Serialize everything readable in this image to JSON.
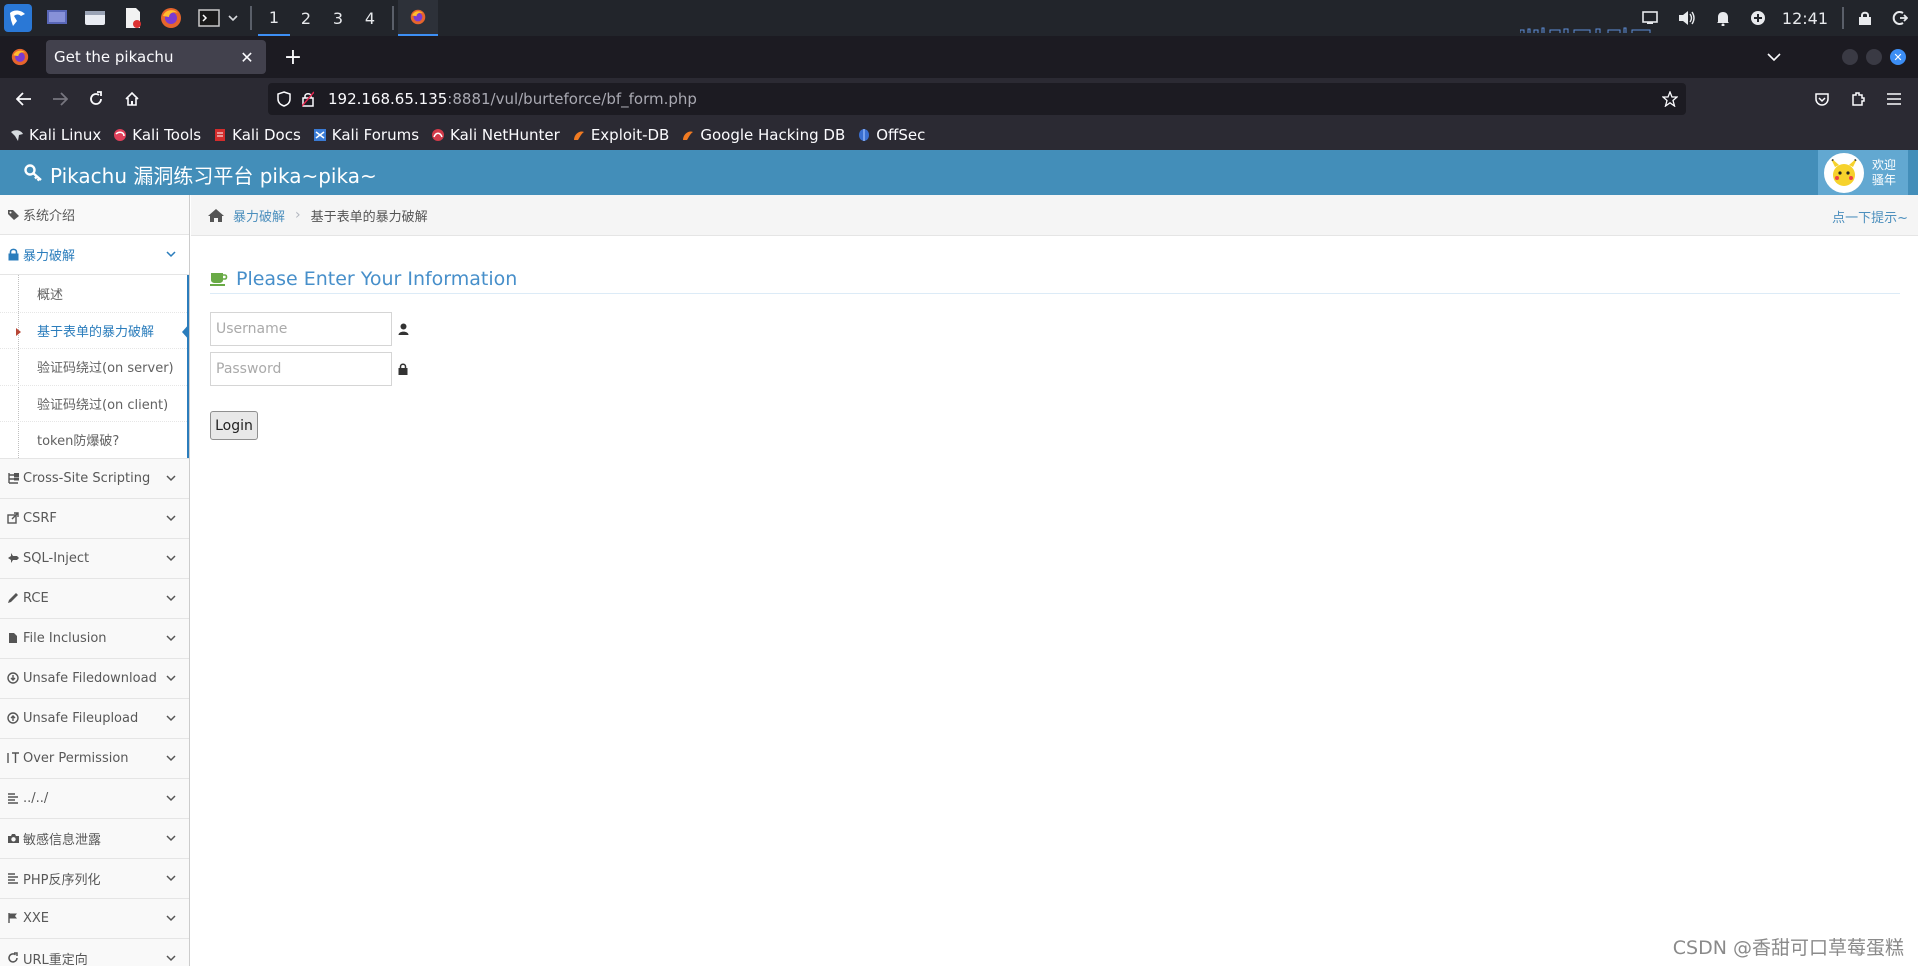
{
  "taskbar": {
    "workspaces": [
      "1",
      "2",
      "3",
      "4"
    ],
    "active_workspace": "1",
    "clock": "12:41",
    "icons": [
      "kali-menu-icon",
      "desktop-icon",
      "file-manager-icon",
      "text-editor-icon",
      "firefox-icon",
      "terminal-icon"
    ]
  },
  "browser": {
    "tab_title": "Get the pikachu",
    "url_host": "192.168.65.135",
    "url_rest": ":8881/vul/burteforce/bf_form.php",
    "bookmarks": [
      "Kali Linux",
      "Kali Tools",
      "Kali Docs",
      "Kali Forums",
      "Kali NetHunter",
      "Exploit-DB",
      "Google Hacking DB",
      "OffSec"
    ]
  },
  "header": {
    "brand": "Pikachu 漏洞练习平台 pika~pika~",
    "welcome_line1": "欢迎",
    "welcome_line2": "骚年"
  },
  "sidebar": {
    "items": [
      {
        "label": "系统介绍",
        "icon": "tags-icon"
      },
      {
        "label": "暴力破解",
        "icon": "lock-icon",
        "open": true
      },
      {
        "label": "Cross-Site Scripting",
        "icon": "sitemap-icon"
      },
      {
        "label": "CSRF",
        "icon": "share-icon"
      },
      {
        "label": "SQL-Inject",
        "icon": "fighter-jet-icon"
      },
      {
        "label": "RCE",
        "icon": "pencil-icon"
      },
      {
        "label": "File Inclusion",
        "icon": "file-icon"
      },
      {
        "label": "Unsafe Filedownload",
        "icon": "download-icon"
      },
      {
        "label": "Unsafe Fileupload",
        "icon": "upload-icon"
      },
      {
        "label": "Over Permission",
        "icon": "text-height-icon"
      },
      {
        "label": "../../",
        "icon": "align-left-icon"
      },
      {
        "label": "敏感信息泄露",
        "icon": "camera-icon"
      },
      {
        "label": "PHP反序列化",
        "icon": "align-left-icon"
      },
      {
        "label": "XXE",
        "icon": "flag-icon"
      },
      {
        "label": "URL重定向",
        "icon": "repeat-icon"
      }
    ],
    "submenu": [
      "概述",
      "基于表单的暴力破解",
      "验证码绕过(on server)",
      "验证码绕过(on client)",
      "token防爆破?"
    ],
    "active_sub": "基于表单的暴力破解"
  },
  "breadcrumb": {
    "link": "暴力破解",
    "current": "基于表单的暴力破解",
    "hint": "点一下提示~"
  },
  "form": {
    "title": "Please Enter Your Information",
    "username_placeholder": "Username",
    "password_placeholder": "Password",
    "login_label": "Login"
  },
  "watermark": "CSDN @香甜可口草莓蛋糕",
  "colors": {
    "header_bg": "#438eb9",
    "link": "#4c8fbd",
    "taskbar_bg": "#22252b",
    "browser_bg": "#2b2a33"
  }
}
